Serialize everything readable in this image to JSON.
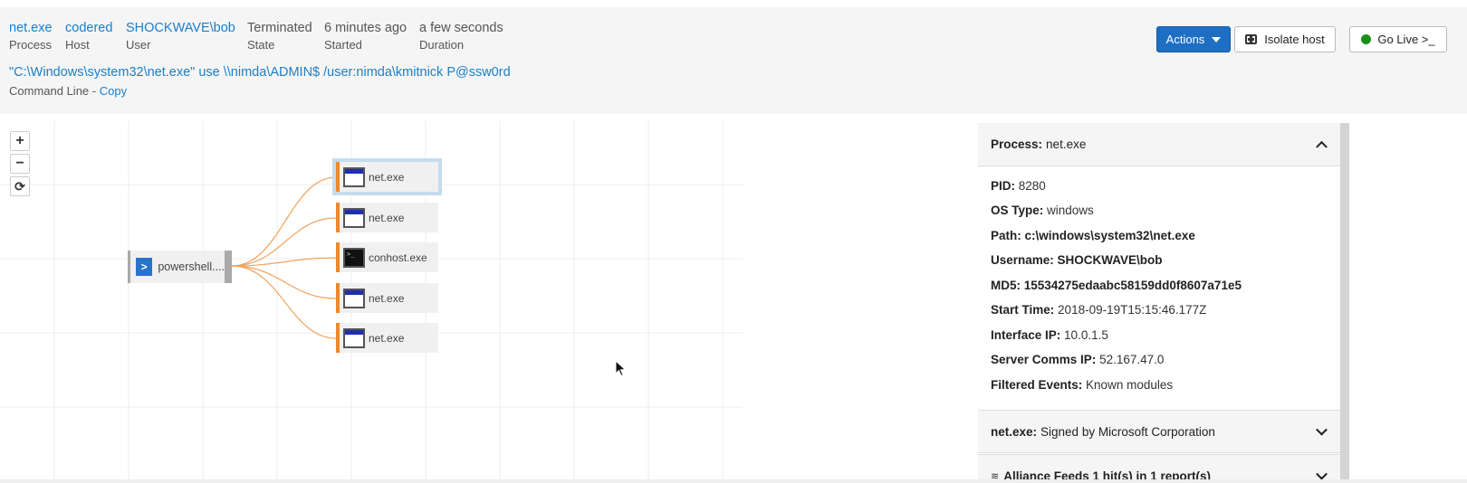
{
  "summary": [
    {
      "value": "net.exe",
      "label": "Process",
      "link": true
    },
    {
      "value": "codered",
      "label": "Host",
      "link": true
    },
    {
      "value": "SHOCKWAVE\\bob",
      "label": "User",
      "link": true
    },
    {
      "value": "Terminated",
      "label": "State",
      "link": false
    },
    {
      "value": "6 minutes ago",
      "label": "Started",
      "link": false
    },
    {
      "value": "a few seconds",
      "label": "Duration",
      "link": false
    }
  ],
  "command_line": {
    "value": "\"C:\\Windows\\system32\\net.exe\" use \\\\nimda\\ADMIN$ /user:nimda\\kmitnick P@ssw0rd",
    "label": "Command Line - ",
    "copy_label": "Copy"
  },
  "toolbar": {
    "actions_label": "Actions",
    "isolate_label": "Isolate host",
    "golive_label": "Go Live >_"
  },
  "zoom": {
    "in_label": "+",
    "out_label": "−",
    "reset_label": "⟳"
  },
  "graph": {
    "parent": {
      "label": "powershell...."
    },
    "children": [
      {
        "label": "net.exe",
        "icon": "window-icon",
        "selected": true
      },
      {
        "label": "net.exe",
        "icon": "window-icon",
        "selected": false
      },
      {
        "label": "conhost.exe",
        "icon": "terminal-icon",
        "selected": false
      },
      {
        "label": "net.exe",
        "icon": "window-icon",
        "selected": false
      },
      {
        "label": "net.exe",
        "icon": "window-icon",
        "selected": false
      }
    ],
    "edge_color": "#f0882a"
  },
  "details": {
    "process_header": {
      "key": "Process:",
      "value": "net.exe"
    },
    "fields": [
      {
        "key": "PID:",
        "value": "8280",
        "bold": false
      },
      {
        "key": "OS Type:",
        "value": "windows",
        "bold": false
      },
      {
        "key": "Path:",
        "value": "c:\\windows\\system32\\net.exe",
        "bold": true
      },
      {
        "key": "Username:",
        "value": "SHOCKWAVE\\bob",
        "bold": true
      },
      {
        "key": "MD5:",
        "value": "15534275edaabc58159dd0f8607a71e5",
        "bold": true
      },
      {
        "key": "Start Time:",
        "value": "2018-09-19T15:15:46.177Z",
        "bold": false
      },
      {
        "key": "Interface IP:",
        "value": "10.0.1.5",
        "bold": false
      },
      {
        "key": "Server Comms IP:",
        "value": "52.167.47.0",
        "bold": false
      },
      {
        "key": "Filtered Events:",
        "value": "Known modules",
        "bold": false
      }
    ],
    "signature_header": {
      "key": "net.exe:",
      "value": "Signed by Microsoft Corporation"
    },
    "alliance_header": {
      "key": "Alliance Feeds 1 hit(s) in 1 report(s)",
      "value": ""
    }
  },
  "colors": {
    "link": "#1a7fc9",
    "primary_button": "#1e6fc4",
    "node_accent": "#f0882a",
    "live_dot": "#1a8f1a"
  }
}
